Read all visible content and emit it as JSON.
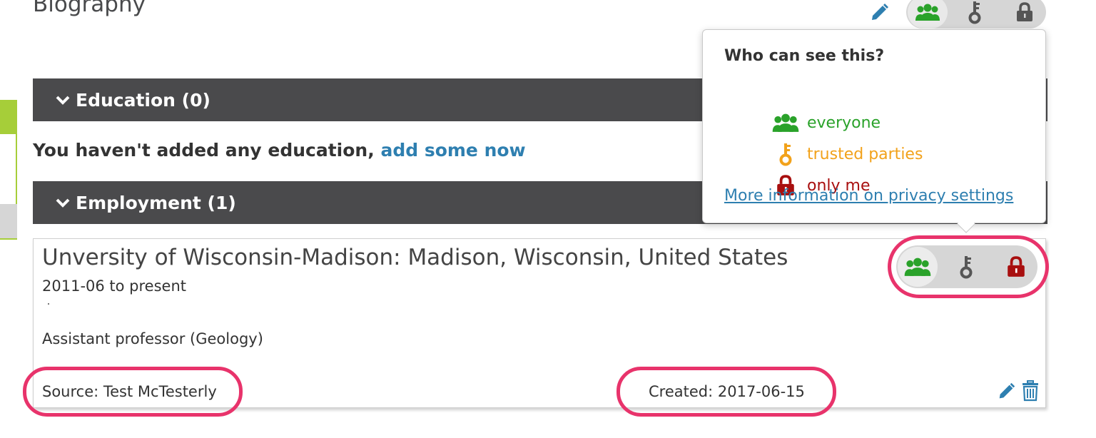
{
  "section_title": "Biography",
  "education": {
    "header": "Education (0)",
    "empty_text": "You haven't added any education,",
    "add_link": "add some now"
  },
  "employment": {
    "header": "Employment (1)",
    "entry": {
      "title": "Unversity of Wisconsin-Madison: Madison, Wisconsin, United States",
      "dates": "2011-06 to present",
      "role": "Assistant professor (Geology)",
      "source": "Source: Test McTesterly",
      "created": "Created: 2017-06-15"
    }
  },
  "privacy_popover": {
    "title": "Who can see this?",
    "options": [
      {
        "label": "everyone",
        "icon": "group-icon",
        "color": "#2aa22a"
      },
      {
        "label": "trusted parties",
        "icon": "key-icon",
        "color": "#f2a21b"
      },
      {
        "label": "only me",
        "icon": "lock-icon",
        "color": "#a80f0f"
      }
    ],
    "more_link": "More information on privacy settings"
  },
  "colors": {
    "accent_link": "#2e7fb0",
    "bar_bg": "#4a4a4c",
    "highlight": "#e8336b",
    "everyone": "#2aa22a",
    "trusted": "#f2a21b",
    "only_me": "#a80f0f"
  }
}
